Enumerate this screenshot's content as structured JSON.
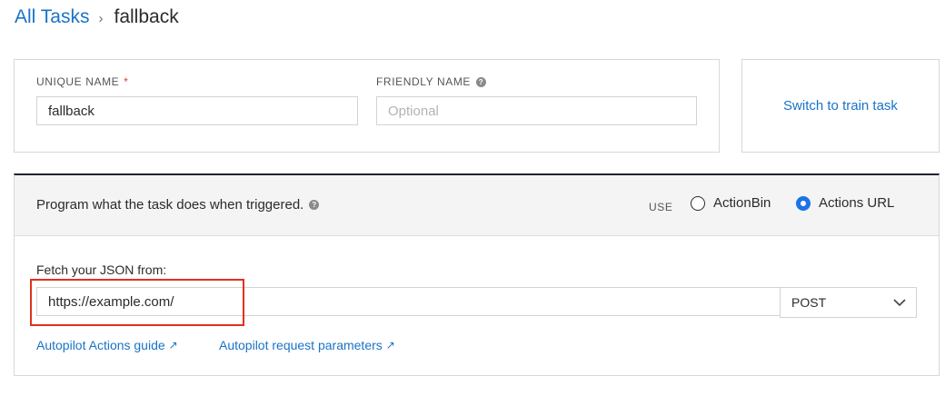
{
  "breadcrumb": {
    "root_label": "All Tasks",
    "separator": "›",
    "current_label": "fallback"
  },
  "names": {
    "unique_label": "UNIQUE NAME",
    "unique_required_mark": "*",
    "unique_value": "fallback",
    "friendly_label": "FRIENDLY NAME",
    "friendly_help_icon": "question-circle-icon",
    "friendly_placeholder": "Optional"
  },
  "switch_card": {
    "link_label": "Switch to train task"
  },
  "program": {
    "title": "Program what the task does when triggered.",
    "title_help_icon": "question-circle-icon",
    "use_label": "USE",
    "options": [
      {
        "label": "ActionBin",
        "checked": false
      },
      {
        "label": "Actions URL",
        "checked": true
      }
    ],
    "fetch_label": "Fetch your JSON from:",
    "url_value": "https://example.com/",
    "method_value": "POST",
    "method_icon": "chevron-down-icon",
    "links": [
      {
        "label": "Autopilot Actions guide",
        "icon": "external-link-icon"
      },
      {
        "label": "Autopilot request parameters",
        "icon": "external-link-icon"
      }
    ]
  },
  "colors": {
    "link": "#1a73c7",
    "radio_selected": "#1a73e8",
    "highlight": "#e0311d",
    "header_rule": "#1f2434"
  }
}
